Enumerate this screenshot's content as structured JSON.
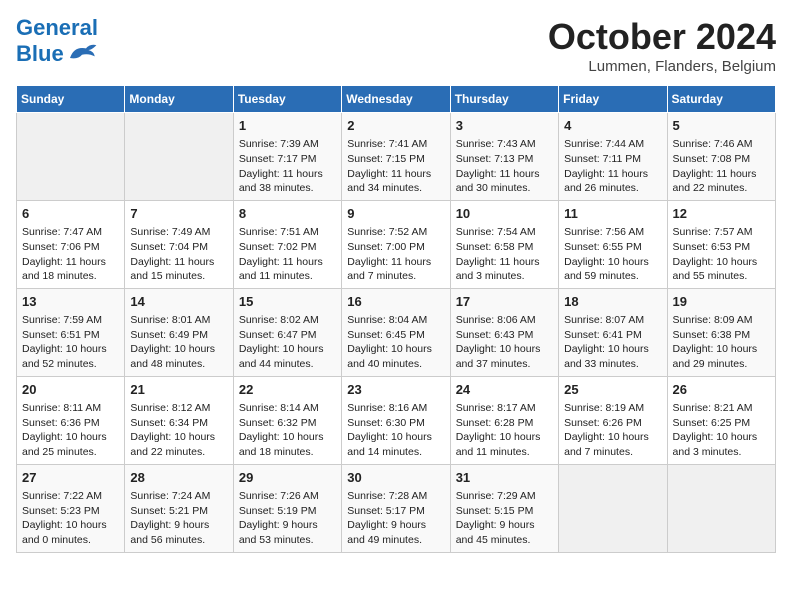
{
  "header": {
    "logo_line1": "General",
    "logo_line2": "Blue",
    "month": "October 2024",
    "location": "Lummen, Flanders, Belgium"
  },
  "weekdays": [
    "Sunday",
    "Monday",
    "Tuesday",
    "Wednesday",
    "Thursday",
    "Friday",
    "Saturday"
  ],
  "weeks": [
    [
      {
        "day": "",
        "info": ""
      },
      {
        "day": "",
        "info": ""
      },
      {
        "day": "1",
        "info": "Sunrise: 7:39 AM\nSunset: 7:17 PM\nDaylight: 11 hours and 38 minutes."
      },
      {
        "day": "2",
        "info": "Sunrise: 7:41 AM\nSunset: 7:15 PM\nDaylight: 11 hours and 34 minutes."
      },
      {
        "day": "3",
        "info": "Sunrise: 7:43 AM\nSunset: 7:13 PM\nDaylight: 11 hours and 30 minutes."
      },
      {
        "day": "4",
        "info": "Sunrise: 7:44 AM\nSunset: 7:11 PM\nDaylight: 11 hours and 26 minutes."
      },
      {
        "day": "5",
        "info": "Sunrise: 7:46 AM\nSunset: 7:08 PM\nDaylight: 11 hours and 22 minutes."
      }
    ],
    [
      {
        "day": "6",
        "info": "Sunrise: 7:47 AM\nSunset: 7:06 PM\nDaylight: 11 hours and 18 minutes."
      },
      {
        "day": "7",
        "info": "Sunrise: 7:49 AM\nSunset: 7:04 PM\nDaylight: 11 hours and 15 minutes."
      },
      {
        "day": "8",
        "info": "Sunrise: 7:51 AM\nSunset: 7:02 PM\nDaylight: 11 hours and 11 minutes."
      },
      {
        "day": "9",
        "info": "Sunrise: 7:52 AM\nSunset: 7:00 PM\nDaylight: 11 hours and 7 minutes."
      },
      {
        "day": "10",
        "info": "Sunrise: 7:54 AM\nSunset: 6:58 PM\nDaylight: 11 hours and 3 minutes."
      },
      {
        "day": "11",
        "info": "Sunrise: 7:56 AM\nSunset: 6:55 PM\nDaylight: 10 hours and 59 minutes."
      },
      {
        "day": "12",
        "info": "Sunrise: 7:57 AM\nSunset: 6:53 PM\nDaylight: 10 hours and 55 minutes."
      }
    ],
    [
      {
        "day": "13",
        "info": "Sunrise: 7:59 AM\nSunset: 6:51 PM\nDaylight: 10 hours and 52 minutes."
      },
      {
        "day": "14",
        "info": "Sunrise: 8:01 AM\nSunset: 6:49 PM\nDaylight: 10 hours and 48 minutes."
      },
      {
        "day": "15",
        "info": "Sunrise: 8:02 AM\nSunset: 6:47 PM\nDaylight: 10 hours and 44 minutes."
      },
      {
        "day": "16",
        "info": "Sunrise: 8:04 AM\nSunset: 6:45 PM\nDaylight: 10 hours and 40 minutes."
      },
      {
        "day": "17",
        "info": "Sunrise: 8:06 AM\nSunset: 6:43 PM\nDaylight: 10 hours and 37 minutes."
      },
      {
        "day": "18",
        "info": "Sunrise: 8:07 AM\nSunset: 6:41 PM\nDaylight: 10 hours and 33 minutes."
      },
      {
        "day": "19",
        "info": "Sunrise: 8:09 AM\nSunset: 6:38 PM\nDaylight: 10 hours and 29 minutes."
      }
    ],
    [
      {
        "day": "20",
        "info": "Sunrise: 8:11 AM\nSunset: 6:36 PM\nDaylight: 10 hours and 25 minutes."
      },
      {
        "day": "21",
        "info": "Sunrise: 8:12 AM\nSunset: 6:34 PM\nDaylight: 10 hours and 22 minutes."
      },
      {
        "day": "22",
        "info": "Sunrise: 8:14 AM\nSunset: 6:32 PM\nDaylight: 10 hours and 18 minutes."
      },
      {
        "day": "23",
        "info": "Sunrise: 8:16 AM\nSunset: 6:30 PM\nDaylight: 10 hours and 14 minutes."
      },
      {
        "day": "24",
        "info": "Sunrise: 8:17 AM\nSunset: 6:28 PM\nDaylight: 10 hours and 11 minutes."
      },
      {
        "day": "25",
        "info": "Sunrise: 8:19 AM\nSunset: 6:26 PM\nDaylight: 10 hours and 7 minutes."
      },
      {
        "day": "26",
        "info": "Sunrise: 8:21 AM\nSunset: 6:25 PM\nDaylight: 10 hours and 3 minutes."
      }
    ],
    [
      {
        "day": "27",
        "info": "Sunrise: 7:22 AM\nSunset: 5:23 PM\nDaylight: 10 hours and 0 minutes."
      },
      {
        "day": "28",
        "info": "Sunrise: 7:24 AM\nSunset: 5:21 PM\nDaylight: 9 hours and 56 minutes."
      },
      {
        "day": "29",
        "info": "Sunrise: 7:26 AM\nSunset: 5:19 PM\nDaylight: 9 hours and 53 minutes."
      },
      {
        "day": "30",
        "info": "Sunrise: 7:28 AM\nSunset: 5:17 PM\nDaylight: 9 hours and 49 minutes."
      },
      {
        "day": "31",
        "info": "Sunrise: 7:29 AM\nSunset: 5:15 PM\nDaylight: 9 hours and 45 minutes."
      },
      {
        "day": "",
        "info": ""
      },
      {
        "day": "",
        "info": ""
      }
    ]
  ]
}
